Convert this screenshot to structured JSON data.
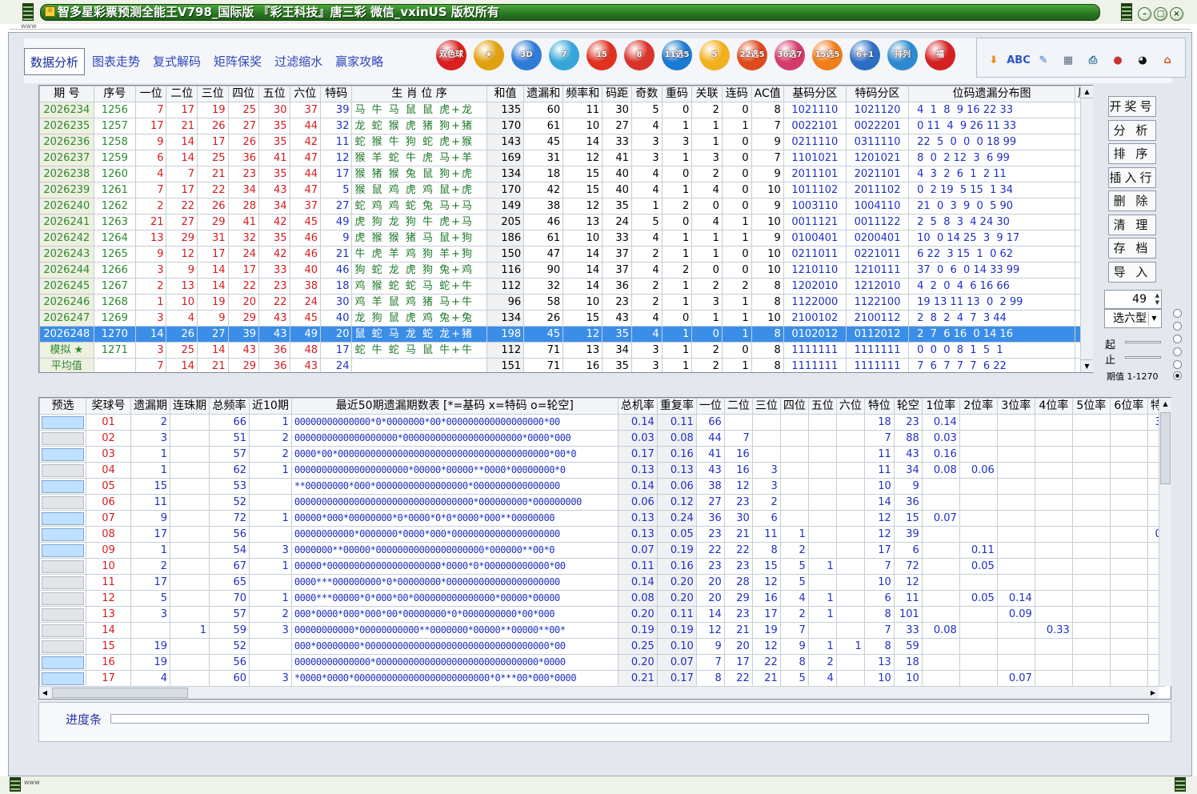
{
  "window": {
    "title": "智多星彩票预测全能王V798_国际版 『彩王科技』唐三彩 微信_vxinUS 版权所有",
    "status_left": "www",
    "corner_label": "sss"
  },
  "tabs": [
    {
      "label": "数据分析"
    },
    {
      "label": "图表走势"
    },
    {
      "label": "复式解码"
    },
    {
      "label": "矩阵保奖"
    },
    {
      "label": "过滤缩水"
    },
    {
      "label": "赢家攻略"
    }
  ],
  "lottery_icons": [
    {
      "name": "双色球",
      "label": "双色球",
      "color": "#d92020"
    },
    {
      "name": "大乐透星",
      "label": "★",
      "color": "#e0a010"
    },
    {
      "name": "3D",
      "label": "3D",
      "color": "#2f7bd6"
    },
    {
      "name": "七星彩",
      "label": "7",
      "color": "#35a6d8"
    },
    {
      "name": "15",
      "label": "15",
      "color": "#e0321e"
    },
    {
      "name": "快乐8",
      "label": "8",
      "color": "#d9332a"
    },
    {
      "name": "11选5",
      "label": "11选5",
      "color": "#1a7bd2"
    },
    {
      "name": "5",
      "label": "5",
      "color": "#f2b01e"
    },
    {
      "name": "22选5",
      "label": "22选5",
      "color": "#e04a1a"
    },
    {
      "name": "36选7",
      "label": "36选7",
      "color": "#d43a6c"
    },
    {
      "name": "15选5",
      "label": "15选5",
      "color": "#f07e1a"
    },
    {
      "name": "6+1",
      "label": "6+1",
      "color": "#2c6fc2"
    },
    {
      "name": "排列",
      "label": "排列",
      "color": "#2c8ad0"
    },
    {
      "name": "福彩",
      "label": "福",
      "color": "#d42020"
    }
  ],
  "tools": [
    {
      "name": "arrow-down",
      "label": "⬇",
      "color": "#f28a13"
    },
    {
      "name": "abc-check",
      "label": "ABC",
      "color": "#2a56c8"
    },
    {
      "name": "edit",
      "label": "✎",
      "color": "#2a76c8"
    },
    {
      "name": "calculator",
      "label": "▦",
      "color": "#5a6a7a"
    },
    {
      "name": "printer",
      "label": "⎙",
      "color": "#2b6a9a"
    },
    {
      "name": "gumball",
      "label": "●",
      "color": "#c33"
    },
    {
      "name": "qq",
      "label": "◕",
      "color": "#111"
    },
    {
      "name": "home",
      "label": "⌂",
      "color": "#c8541a"
    }
  ],
  "history_table": {
    "headers": [
      "期 号",
      "序号",
      "一位",
      "二位",
      "三位",
      "四位",
      "五位",
      "六位",
      "特码",
      "生 肖 位 序",
      "和值",
      "遗漏和",
      "频率和",
      "码距",
      "奇数",
      "重码",
      "关联",
      "连码",
      "AC值",
      "基码分区",
      "特码分区",
      "位码遗漏分布图",
      "尾"
    ],
    "rows": [
      [
        "2026234",
        "1256",
        "7",
        "17",
        "19",
        "25",
        "30",
        "37",
        "39",
        "马 牛 马 鼠 鼠 虎+龙",
        "135",
        "60",
        "11",
        "30",
        "5",
        "0",
        "2",
        "0",
        "8",
        "1021110",
        "1021120",
        "4  1  8  9 16 22 33"
      ],
      [
        "2026235",
        "1257",
        "17",
        "21",
        "26",
        "27",
        "35",
        "44",
        "32",
        "龙 蛇 猴 虎 猪 狗+猪",
        "170",
        "61",
        "10",
        "27",
        "4",
        "1",
        "1",
        "1",
        "7",
        "0022101",
        "0022201",
        "0 11  4  9 26 11 33"
      ],
      [
        "2026236",
        "1258",
        "9",
        "14",
        "17",
        "26",
        "35",
        "42",
        "11",
        "蛇 猴 牛 狗 蛇 虎+猴",
        "143",
        "45",
        "14",
        "33",
        "3",
        "3",
        "1",
        "0",
        "9",
        "0211110",
        "0311110",
        "22  5  0  0  0 18 99"
      ],
      [
        "2026237",
        "1259",
        "6",
        "14",
        "25",
        "36",
        "41",
        "47",
        "12",
        "猴 羊 蛇 牛 虎 马+羊",
        "169",
        "31",
        "12",
        "41",
        "3",
        "1",
        "3",
        "0",
        "7",
        "1101021",
        "1201021",
        "8  0  2 12  3  6 99"
      ],
      [
        "2026238",
        "1260",
        "4",
        "7",
        "21",
        "23",
        "35",
        "44",
        "17",
        "猴 猪 猴 兔 鼠 狗+虎",
        "134",
        "18",
        "15",
        "40",
        "4",
        "0",
        "2",
        "0",
        "9",
        "2011101",
        "2021101",
        "4  3  2  6  1  2 11"
      ],
      [
        "2026239",
        "1261",
        "7",
        "17",
        "22",
        "34",
        "43",
        "47",
        "5",
        "猴 鼠 鸡 虎 鸡 鼠+虎",
        "170",
        "42",
        "15",
        "40",
        "4",
        "1",
        "4",
        "0",
        "10",
        "1011102",
        "2011102",
        "0  2 19  5 15  1 34"
      ],
      [
        "2026240",
        "1262",
        "2",
        "22",
        "26",
        "28",
        "34",
        "37",
        "27",
        "蛇 鸡 鸡 蛇 兔 马+马",
        "149",
        "38",
        "12",
        "35",
        "1",
        "2",
        "0",
        "0",
        "9",
        "1003110",
        "1004110",
        "21  0  3  9  0  5 90"
      ],
      [
        "2026241",
        "1263",
        "21",
        "27",
        "29",
        "41",
        "42",
        "45",
        "49",
        "虎 狗 龙 狗 牛 虎+马",
        "205",
        "46",
        "13",
        "24",
        "5",
        "0",
        "4",
        "1",
        "10",
        "0011121",
        "0011122",
        "2  5  8  3  4 24 30"
      ],
      [
        "2026242",
        "1264",
        "13",
        "29",
        "31",
        "32",
        "35",
        "46",
        "9",
        "虎 猴 猴 猪 马 鼠+狗",
        "186",
        "61",
        "10",
        "33",
        "4",
        "1",
        "1",
        "1",
        "9",
        "0100401",
        "0200401",
        "10  0 14 25  3  9 17"
      ],
      [
        "2026243",
        "1265",
        "9",
        "12",
        "17",
        "24",
        "42",
        "46",
        "21",
        "牛 虎 羊 鸡 狗 羊+狗",
        "150",
        "47",
        "14",
        "37",
        "2",
        "1",
        "1",
        "0",
        "10",
        "0211011",
        "0221011",
        "6 22  3 15  1  0 62"
      ],
      [
        "2026244",
        "1266",
        "3",
        "9",
        "14",
        "17",
        "33",
        "40",
        "46",
        "狗 蛇 龙 虎 狗 兔+鸡",
        "116",
        "90",
        "14",
        "37",
        "4",
        "2",
        "0",
        "0",
        "10",
        "1210110",
        "1210111",
        "37  0  6  0 14 33 99"
      ],
      [
        "2026245",
        "1267",
        "2",
        "13",
        "14",
        "22",
        "23",
        "38",
        "18",
        "鸡 猴 蛇 蛇 马 蛇+牛",
        "112",
        "32",
        "14",
        "36",
        "2",
        "1",
        "2",
        "2",
        "8",
        "1202010",
        "1212010",
        "4  2  0  4  6 16 66"
      ],
      [
        "2026246",
        "1268",
        "1",
        "10",
        "19",
        "20",
        "22",
        "24",
        "30",
        "鸡 羊 鼠 鸡 猪 马+牛",
        "96",
        "58",
        "10",
        "23",
        "2",
        "1",
        "3",
        "1",
        "8",
        "1122000",
        "1122100",
        "19 13 11 13  0  2 99"
      ],
      [
        "2026247",
        "1269",
        "3",
        "4",
        "9",
        "29",
        "43",
        "45",
        "40",
        "龙 狗 鼠 虎 鸡 兔+兔",
        "134",
        "26",
        "15",
        "43",
        "4",
        "0",
        "1",
        "1",
        "10",
        "2100102",
        "2100112",
        "2  8  2  4  7  3 44"
      ],
      [
        "2026248",
        "1270",
        "14",
        "26",
        "27",
        "39",
        "43",
        "49",
        "20",
        "鼠 蛇 马 龙 蛇 龙+猪",
        "198",
        "45",
        "12",
        "35",
        "4",
        "1",
        "0",
        "1",
        "8",
        "0102012",
        "0112012",
        "2  7  6 16  0 14 16"
      ],
      [
        "模拟 ★",
        "1271",
        "3",
        "25",
        "14",
        "43",
        "36",
        "48",
        "17",
        "蛇 牛 蛇 马 鼠 牛+牛",
        "112",
        "71",
        "13",
        "34",
        "3",
        "1",
        "2",
        "0",
        "8",
        "1111111",
        "1111111",
        "0  0  0  8  1  5  1"
      ],
      [
        "平均值",
        "",
        "7",
        "14",
        "21",
        "29",
        "36",
        "43",
        "24",
        "",
        "151",
        "71",
        "16",
        "35",
        "3",
        "1",
        "2",
        "1",
        "8",
        "1111111",
        "1111111",
        "7  6  7  7  7  6 22"
      ]
    ],
    "selected_row": 14
  },
  "side_buttons": [
    "开奖号",
    "分 析",
    "排 序",
    "插入行",
    "删 除",
    "清 理",
    "存 档",
    "导 入"
  ],
  "spin_value": "49",
  "select_value": "选六型",
  "range_labels": {
    "start": "起",
    "end": "止",
    "period": "期值 1-1270"
  },
  "ball_table": {
    "headers": [
      "预选",
      "奖球号",
      "遗漏期",
      "连珠期",
      "总频率",
      "近10期",
      "最近50期遗漏期数表 [*=基码 x=特码 o=轮空]",
      "总机率",
      "重复率",
      "一位",
      "二位",
      "三位",
      "四位",
      "五位",
      "六位",
      "特位",
      "轮空",
      "1位率",
      "2位率",
      "3位率",
      "4位率",
      "5位率",
      "6位率",
      "特"
    ],
    "rows": [
      [
        "01",
        "2",
        "",
        "66",
        "1",
        "00000000000000*0*0000000*00*000000000000000000*00",
        "0.14",
        "0.11",
        "66",
        "",
        "",
        "",
        "",
        "",
        "18",
        "23",
        "0.14",
        "",
        "",
        "",
        "",
        "",
        "3"
      ],
      [
        "02",
        "3",
        "",
        "51",
        "2",
        "0000000000000000000*0000000000000000000000*0000*000",
        "0.03",
        "0.08",
        "44",
        "7",
        "",
        "",
        "",
        "",
        "7",
        "88",
        "0.03",
        "",
        "",
        "",
        "",
        "",
        ""
      ],
      [
        "03",
        "1",
        "",
        "57",
        "2",
        "0000*00*000000000000000000000000000000000000000*00*0",
        "0.17",
        "0.16",
        "41",
        "16",
        "",
        "",
        "",
        "",
        "11",
        "43",
        "0.16",
        "",
        "",
        "",
        "",
        "",
        ""
      ],
      [
        "04",
        "1",
        "",
        "62",
        "1",
        "000000000000000000000*00000*00000**0000*00000000*0",
        "0.13",
        "0.13",
        "43",
        "16",
        "3",
        "",
        "",
        "",
        "11",
        "34",
        "0.08",
        "0.06",
        "",
        "",
        "",
        "",
        ""
      ],
      [
        "05",
        "15",
        "",
        "53",
        "",
        "**00000000*000*00000000000000000*0000000000000000",
        "0.14",
        "0.06",
        "38",
        "12",
        "3",
        "",
        "",
        "",
        "10",
        "9",
        "",
        "",
        "",
        "",
        "",
        "",
        ""
      ],
      [
        "06",
        "11",
        "",
        "52",
        "",
        "000000000000000000000000000000000*000000000*000000000",
        "0.06",
        "0.12",
        "27",
        "23",
        "2",
        "",
        "",
        "",
        "14",
        "36",
        "",
        "",
        "",
        "",
        "",
        "",
        ""
      ],
      [
        "07",
        "9",
        "",
        "72",
        "1",
        "00000*000*00000000*0*0000*0*0*0000*000**00000000",
        "0.13",
        "0.24",
        "36",
        "30",
        "6",
        "",
        "",
        "",
        "12",
        "15",
        "0.07",
        "",
        "",
        "",
        "",
        "",
        ""
      ],
      [
        "08",
        "17",
        "",
        "56",
        "",
        "00000000000*0000000*0000*000*00000000000000000000",
        "0.13",
        "0.05",
        "23",
        "21",
        "11",
        "1",
        "",
        "",
        "12",
        "39",
        "",
        "",
        "",
        "",
        "",
        "",
        "0"
      ],
      [
        "09",
        "1",
        "",
        "54",
        "3",
        "0000000**00000*00000000000000000000*000000**00*0",
        "0.07",
        "0.19",
        "22",
        "22",
        "8",
        "2",
        "",
        "",
        "17",
        "6",
        "",
        "0.11",
        "",
        "",
        "",
        "",
        ""
      ],
      [
        "10",
        "2",
        "",
        "67",
        "1",
        "00000*000000000000000000000*0000*0*000000000000*00",
        "0.11",
        "0.16",
        "23",
        "23",
        "15",
        "5",
        "1",
        "",
        "7",
        "72",
        "",
        "0.05",
        "",
        "",
        "",
        "",
        ""
      ],
      [
        "11",
        "17",
        "",
        "65",
        "",
        "0000***000000000*0*00000000*000000000000000000000",
        "0.14",
        "0.20",
        "20",
        "28",
        "12",
        "5",
        "",
        "",
        "10",
        "12",
        "",
        "",
        "",
        "",
        "",
        "",
        ""
      ],
      [
        "12",
        "5",
        "",
        "70",
        "1",
        "0000***00000*0*000*00*000000000000000*00000*00000",
        "0.08",
        "0.20",
        "20",
        "29",
        "16",
        "4",
        "1",
        "",
        "6",
        "11",
        "",
        "0.05",
        "0.14",
        "",
        "",
        "",
        ""
      ],
      [
        "13",
        "3",
        "",
        "57",
        "2",
        "000*0000*000*000*00*00000000*0*0000000000*00*000",
        "0.20",
        "0.11",
        "14",
        "23",
        "17",
        "2",
        "1",
        "",
        "8",
        "101",
        "",
        "",
        "0.09",
        "",
        "",
        "",
        ""
      ],
      [
        "14",
        "",
        "1",
        "59",
        "3",
        "00000000000*00000000000**0000000*00000**00000**00*",
        "0.19",
        "0.19",
        "12",
        "21",
        "19",
        "7",
        "",
        "",
        "7",
        "33",
        "0.08",
        "",
        "",
        "0.33",
        "",
        "",
        ""
      ],
      [
        "15",
        "19",
        "",
        "52",
        "",
        "000*00000000*0000000000000000000000000000000000*00",
        "0.25",
        "0.10",
        "9",
        "20",
        "12",
        "9",
        "1",
        "1",
        "8",
        "59",
        "",
        "",
        "",
        "",
        "",
        "",
        ""
      ],
      [
        "16",
        "19",
        "",
        "56",
        "",
        "00000000000000*000000000000000000000000000000*0000",
        "0.20",
        "0.07",
        "7",
        "17",
        "22",
        "8",
        "2",
        "",
        "13",
        "18",
        "",
        "",
        "",
        "",
        "",
        "",
        ""
      ],
      [
        "17",
        "4",
        "",
        "60",
        "3",
        "*0000*0000*0000000000000000000000000*0***00*000*0000",
        "0.21",
        "0.17",
        "8",
        "22",
        "21",
        "5",
        "4",
        "",
        "10",
        "10",
        "",
        "",
        "0.07",
        "",
        "",
        "",
        ""
      ]
    ],
    "preselect": [
      true,
      false,
      true,
      false,
      true,
      false,
      true,
      true,
      true,
      false,
      false,
      false,
      false,
      false,
      false,
      true,
      true
    ]
  },
  "progress": {
    "label": "进度条",
    "value": 0
  }
}
